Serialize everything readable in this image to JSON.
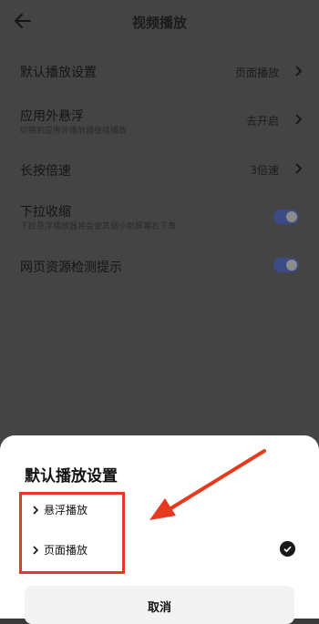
{
  "header": {
    "title": "视频播放",
    "back_icon": "back-arrow-icon"
  },
  "settings": [
    {
      "title": "默认播放设置",
      "value": "页面播放",
      "control": "chevron"
    },
    {
      "title": "应用外悬浮",
      "subtitle": "切换到应用外播放器继续播放",
      "value": "去开启",
      "control": "chevron"
    },
    {
      "title": "长按倍速",
      "value": "3倍速",
      "control": "chevron"
    },
    {
      "title": "下拉收缩",
      "subtitle": "下拉悬浮播放器将会使其缩小到屏幕右下角",
      "control": "toggle",
      "on": true
    },
    {
      "title": "网页资源检测提示",
      "control": "toggle",
      "on": true
    }
  ],
  "sheet": {
    "title": "默认播放设置",
    "options": [
      {
        "label": "悬浮播放",
        "selected": false
      },
      {
        "label": "页面播放",
        "selected": true
      }
    ],
    "cancel_label": "取消"
  },
  "colors": {
    "dim_background": "#444444",
    "toggle_on": "#3c4a86",
    "annotation_red": "#e63a1f",
    "sheet_background": "#ffffff"
  }
}
